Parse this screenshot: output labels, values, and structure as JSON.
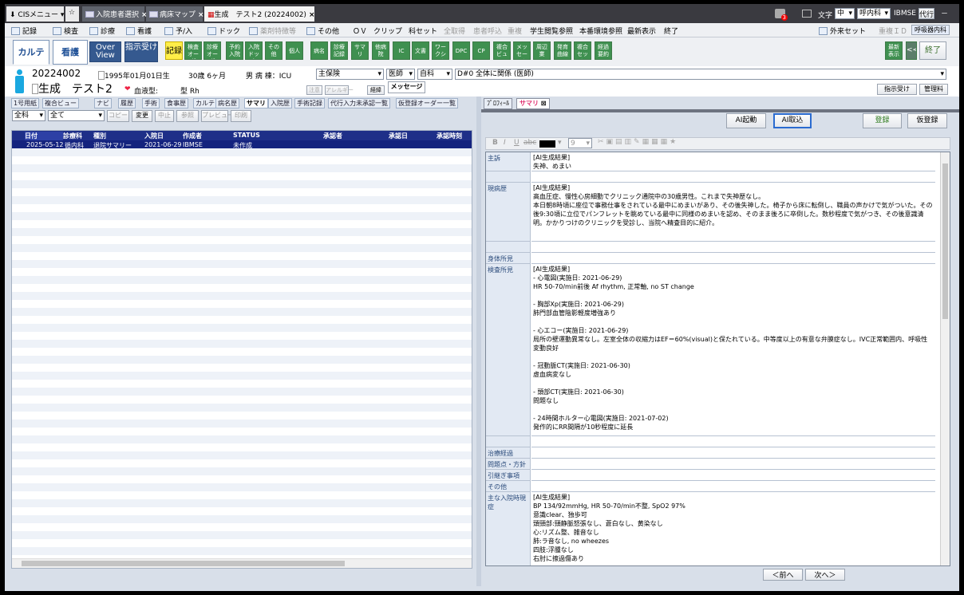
{
  "window": {
    "cis_menu": "CISメニュー",
    "tabs": [
      {
        "label": "入院患者選択"
      },
      {
        "label": "病床マップ"
      },
      {
        "label": "生成　テスト2 (20224002)"
      }
    ],
    "badge": "3",
    "text_size_label": "文字",
    "text_size_value": "中",
    "dept_value": "呼内科",
    "user": "IBMSE",
    "proxy": "代行"
  },
  "menu": [
    {
      "label": "記録"
    },
    {
      "label": "検査"
    },
    {
      "label": "診療"
    },
    {
      "label": "看護"
    },
    {
      "label": "予/入"
    },
    {
      "label": "ドック"
    },
    {
      "label": "薬剤特徴等"
    },
    {
      "label": "その他"
    },
    {
      "label": "ＯＶ"
    },
    {
      "label": "クリップ"
    },
    {
      "label": "科セット"
    },
    {
      "label": "全取得"
    },
    {
      "label": "患者呼込"
    },
    {
      "label": "重複"
    },
    {
      "label": "学生閲覧参照"
    },
    {
      "label": "本番環境参照"
    },
    {
      "label": "最新表示"
    },
    {
      "label": "終了"
    }
  ],
  "menu_right": {
    "outpatient": "外来セット",
    "dup_id": "重複ＩＤ",
    "resp": "呼吸器内科"
  },
  "toolbar": {
    "main_tabs": [
      "カルテ",
      "看護",
      "Over View",
      "指示受け"
    ],
    "kiroku": "記録",
    "buttons": [
      "検査オーダ",
      "診療オーダ",
      "予約入院",
      "入院ドック",
      "その他",
      "個人",
      "病名",
      "診療記録",
      "サマリ",
      "他病院",
      "IC",
      "文書",
      "ワークシート",
      "DPC",
      "CP",
      "複合ビュー",
      "メッセージ",
      "周辺業",
      "発育曲線",
      "複合セット",
      "経過要約"
    ],
    "latest": "最新表示",
    "back": "<<",
    "end": "終了"
  },
  "patient": {
    "id": "20224002",
    "name": "生成　テスト2",
    "dob": "1995年01月01日生",
    "age": "30歳 6ヶ月",
    "sex_ward": "男 病 棟：ICU",
    "insurance": "主保険",
    "doctor": "医師",
    "dept": "自科",
    "disease": "D#0 全体に関係 (医師)",
    "blood_label": "血液型:",
    "blood_value": "型 Rh",
    "btn_small1": "注意",
    "btn_small2": "アレルギー",
    "summary_btn": "経緯",
    "message_btn": "メッセージ",
    "receive_btn": "指示受け",
    "admin_btn": "管理料"
  },
  "left": {
    "tabs": [
      "1号用紙",
      "複合ビュー",
      "ナビ",
      "履歴",
      "手術",
      "食事歴",
      "カルテ",
      "病名歴",
      "サマリ",
      "入院歴",
      "手術記録",
      "代行入力未承認一覧",
      "仮登録オーダー一覧"
    ],
    "filter1": "全科",
    "filter2": "全て",
    "buttons": [
      "コピー",
      "変更",
      "中止",
      "参照",
      "プレビュー",
      "印刷"
    ],
    "columns": [
      "日付",
      "診療科",
      "種別",
      "入院日",
      "作成者",
      "STATUS",
      "承認者",
      "承認日",
      "承認時刻"
    ],
    "rows": [
      [
        "2025-05-12",
        "循内科",
        "退院サマリー",
        "2021-06-29",
        "IBMSE",
        "未作成",
        "",
        "",
        ""
      ]
    ]
  },
  "right": {
    "tabs": [
      "ﾌﾟﾛﾌｨｰﾙ",
      "サマリ"
    ],
    "ai_start": "AI起動",
    "ai_import": "AI取込",
    "register": "登録",
    "temp_register": "仮登録",
    "font_size": "9",
    "sections": [
      {
        "label": "主訴",
        "text": "[AI生成結果]\n失神、めまい"
      },
      {
        "label": "",
        "text": ""
      },
      {
        "label": "現病歴",
        "text": "[AI生成結果]\n高血圧症、慢性心房細動でクリニック通院中の30歳男性。これまで失神歴なし。\n本日朝8時頃に座位で事務仕事をされている最中にめまいがあり、その後失神した。椅子から床に転倒し、職員の声かけで気がついた。その後9:30頃に立位でパンフレットを眺めている最中に同様のめまいを認め、そのまま後ろに卒倒した。数秒程度で気がつき、その後意識清明。かかりつけのクリニックを受診し、当院へ精査目的に紹介。"
      },
      {
        "label": "",
        "text": ""
      },
      {
        "label": "身体所見",
        "text": ""
      },
      {
        "label": "検査所見",
        "text": "[AI生成結果]\n- 心電図(実施日: 2021-06-29)\nHR 50-70/min前後 Af rhythm, 正常軸, no ST change\n\n- 胸部Xp(実施日: 2021-06-29)\n肺門部血管陰影軽度増強あり\n\n- 心エコー(実施日: 2021-06-29)\n局所の壁運動異常なし。左室全体の収縮力はEF＝60%(visual)と保たれている。中等度以上の有意な弁膜症なし。IVC正常範囲内、呼吸性変動良好\n\n- 冠動脈CT(実施日: 2021-06-30)\n虚血病変なし\n\n- 頭部CT(実施日: 2021-06-30)\n問題なし\n\n- 24時間ホルター心電図(実施日: 2021-07-02)\n発作的にRR間隔が10秒程度に延長"
      },
      {
        "label": "",
        "text": ""
      },
      {
        "label": "治療経過",
        "text": ""
      },
      {
        "label": "問題点・方針",
        "text": ""
      },
      {
        "label": "引継ぎ事項",
        "text": ""
      },
      {
        "label": "その他",
        "text": ""
      },
      {
        "label": "主な入院時現症",
        "text": "[AI生成結果]\nBP 134/92mmHg, HR 50-70/min不整, SpO2 97%\n意識clear、独歩可\n頭頸部:頸静脈怒張なし、蒼白なし、黄染なし\n心:リズム整、雑音なし\n肺:ラ音なし, no wheezes\n四肢:浮腫なし\n右肘に擦過傷あり"
      }
    ],
    "prev": "＜前へ",
    "next": "次へ＞"
  }
}
